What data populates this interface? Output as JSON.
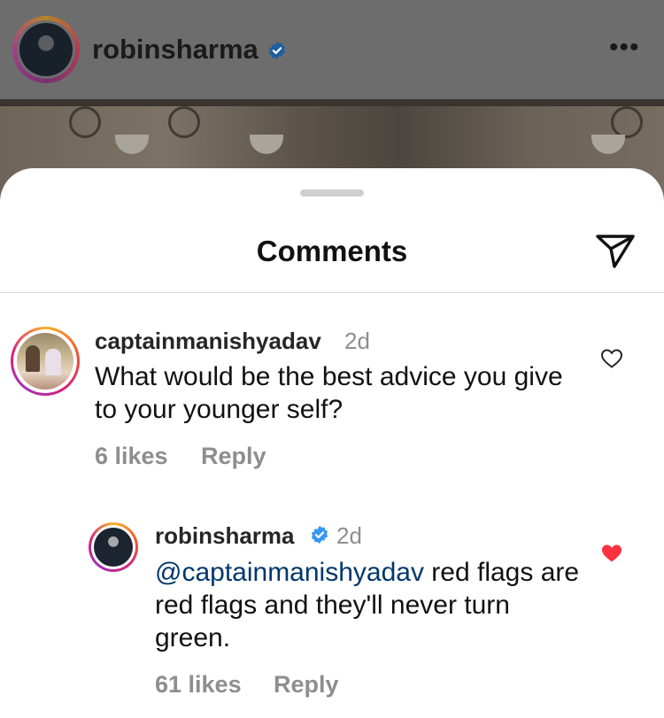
{
  "post_header": {
    "username": "robinsharma",
    "more_icon": "more-horizontal-icon"
  },
  "sheet": {
    "title": "Comments",
    "share_icon": "send-icon"
  },
  "comments": [
    {
      "username": "captainmanishyadav",
      "time": "2d",
      "text": "What would be the best advice you give to your younger self?",
      "likes": "6 likes",
      "reply_label": "Reply",
      "liked": false
    },
    {
      "username": "robinsharma",
      "verified": true,
      "time": "2d",
      "mention": "@captainmanishyadav",
      "text": " red flags are red flags and they'll never turn green.",
      "likes": "61 likes",
      "reply_label": "Reply",
      "liked": true
    }
  ],
  "colors": {
    "verified_blue": "#3897f0",
    "like_red": "#ff3040",
    "mention_blue": "#00376b",
    "secondary_text": "#8e8e8e"
  }
}
